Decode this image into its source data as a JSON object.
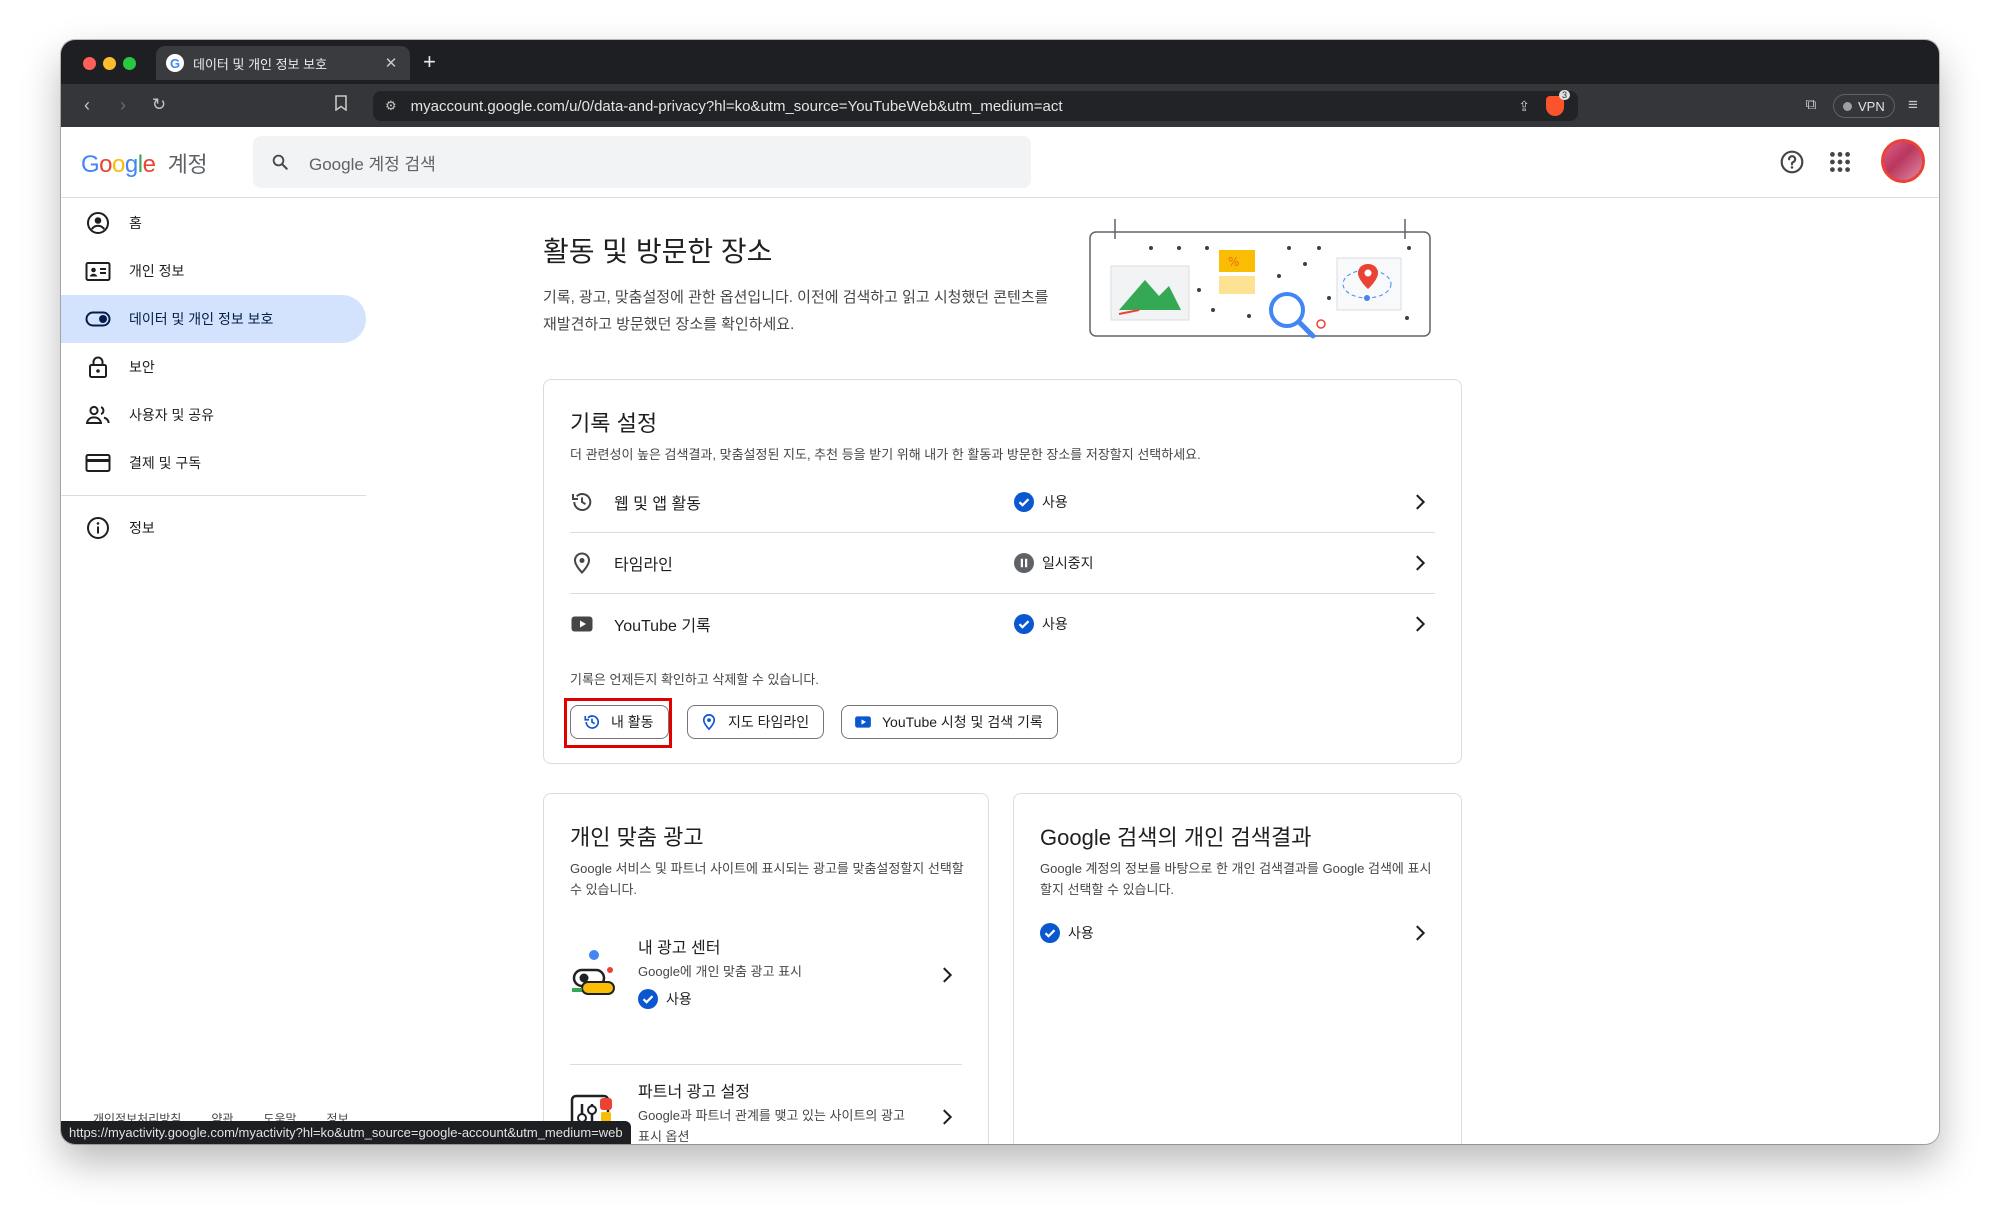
{
  "browser": {
    "tab_title": "데이터 및 개인 정보 보호",
    "tab_favicon": "G",
    "url": "myaccount.google.com/u/0/data-and-privacy?hl=ko&utm_source=YouTubeWeb&utm_medium=act",
    "vpn_label": "VPN",
    "brave_badge": "3",
    "status_url": "https://myactivity.google.com/myactivity?hl=ko&utm_source=google-account&utm_medium=web"
  },
  "header": {
    "logo_text": "Google",
    "logo_sub": "계정",
    "search_placeholder": "Google 계정 검색"
  },
  "sidebar": {
    "items": [
      {
        "label": "홈",
        "icon": "account-circle-icon"
      },
      {
        "label": "개인 정보",
        "icon": "id-card-icon"
      },
      {
        "label": "데이터 및 개인 정보 보호",
        "icon": "toggle-icon",
        "active": true
      },
      {
        "label": "보안",
        "icon": "lock-icon"
      },
      {
        "label": "사용자 및 공유",
        "icon": "people-icon"
      },
      {
        "label": "결제 및 구독",
        "icon": "credit-card-icon"
      }
    ],
    "info_item": {
      "label": "정보",
      "icon": "info-icon"
    }
  },
  "footer_links": [
    "개인정보처리방침",
    "약관",
    "도움말",
    "정보"
  ],
  "main": {
    "title": "활동 및 방문한 장소",
    "description": "기록, 광고, 맞춤설정에 관한 옵션입니다. 이전에 검색하고 읽고 시청했던 콘텐츠를 재발견하고 방문했던 장소를 확인하세요."
  },
  "history_card": {
    "title": "기록 설정",
    "description": "더 관련성이 높은 검색결과, 맞춤설정된 지도, 추천 등을 받기 위해 내가 한 활동과 방문한 장소를 저장할지 선택하세요.",
    "rows": [
      {
        "label": "웹 및 앱 활동",
        "status": "사용",
        "status_type": "on",
        "icon": "history-icon"
      },
      {
        "label": "타임라인",
        "status": "일시중지",
        "status_type": "paused",
        "icon": "location-pin-icon"
      },
      {
        "label": "YouTube 기록",
        "status": "사용",
        "status_type": "on",
        "icon": "youtube-icon"
      }
    ],
    "footer_note": "기록은 언제든지 확인하고 삭제할 수 있습니다.",
    "chips": [
      {
        "label": "내 활동",
        "icon": "history-icon",
        "highlighted": true
      },
      {
        "label": "지도 타임라인",
        "icon": "location-pin-icon"
      },
      {
        "label": "YouTube 시청 및 검색 기록",
        "icon": "youtube-icon"
      }
    ]
  },
  "ads_card": {
    "title": "개인 맞춤 광고",
    "description": "Google 서비스 및 파트너 사이트에 표시되는 광고를 맞춤설정할지 선택할 수 있습니다.",
    "items": [
      {
        "title": "내 광고 센터",
        "subtitle": "Google에 개인 맞춤 광고 표시",
        "status": "사용"
      },
      {
        "title": "파트너 광고 설정",
        "subtitle": "Google과 파트너 관계를 맺고 있는 사이트의 광고 표시 옵션"
      }
    ]
  },
  "search_card": {
    "title": "Google 검색의 개인 검색결과",
    "description": "Google 계정의 정보를 바탕으로 한 개인 검색결과를 Google 검색에 표시할지 선택할 수 있습니다.",
    "status": "사용"
  },
  "colors": {
    "accent_blue": "#0b57d0",
    "active_nav_bg": "#d3e3fd",
    "highlight_red": "#e00000",
    "paused_gray": "#5f6368"
  }
}
